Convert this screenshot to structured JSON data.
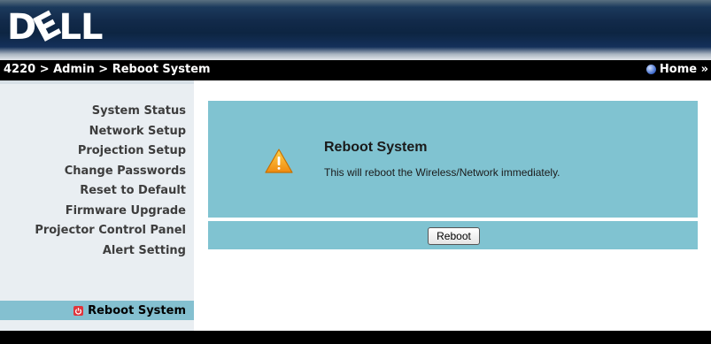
{
  "header": {
    "logo_text": "DELL",
    "logo_icon": "dell-logo"
  },
  "breadcrumb": {
    "text": "4220 > Admin > Reboot System"
  },
  "home": {
    "label": "Home »",
    "icon": "globe-icon"
  },
  "sidebar": {
    "items": [
      {
        "label": "System Status"
      },
      {
        "label": "Network Setup"
      },
      {
        "label": "Projection Setup"
      },
      {
        "label": "Change Passwords"
      },
      {
        "label": "Reset to Default"
      },
      {
        "label": "Firmware Upgrade"
      },
      {
        "label": "Projector Control Panel"
      },
      {
        "label": "Alert Setting"
      }
    ],
    "active_item": {
      "label": "Reboot System",
      "icon": "power-icon"
    }
  },
  "panel": {
    "icon": "warning-icon",
    "title": "Reboot System",
    "message": "This will reboot the Wireless/Network immediately."
  },
  "actions": {
    "reboot_label": "Reboot"
  },
  "colors": {
    "panel_bg": "#80c3d1",
    "active_item_bg": "#84c0d0",
    "sidebar_bg": "#e9eef2",
    "warning": "#f0a020"
  }
}
